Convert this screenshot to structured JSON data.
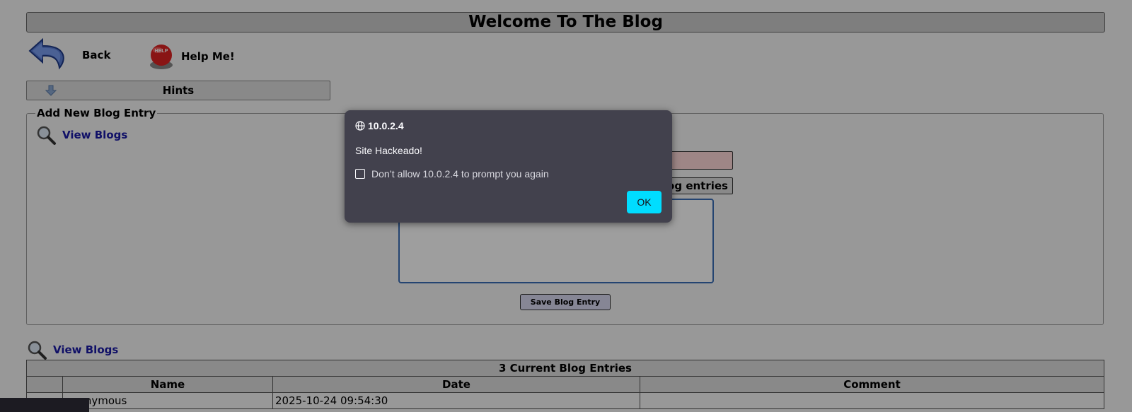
{
  "header": {
    "title": "Welcome To The Blog"
  },
  "nav": {
    "back_label": "Back",
    "help_label": "Help Me!",
    "help_badge": "HELP"
  },
  "hints": {
    "label": "Hints"
  },
  "form": {
    "legend": "Add New Blog Entry",
    "view_blogs_label": "View Blogs",
    "show_entries_label": "Show blog entries",
    "save_label": "Save Blog Entry"
  },
  "blog_list": {
    "view_blogs_label": "View Blogs",
    "caption": "3 Current Blog Entries",
    "columns": [
      "",
      "Name",
      "Date",
      "Comment"
    ],
    "rows": [
      {
        "index": "",
        "name": "anonymous",
        "date": "2025-10-24 09:54:30",
        "comment": ""
      }
    ]
  },
  "dialog": {
    "origin": "10.0.2.4",
    "message": "Site Hackeado!",
    "checkbox_label": "Don’t allow 10.0.2.4 to prompt you again",
    "checkbox_checked": false,
    "ok_label": "OK",
    "accent_color": "#00ddff",
    "background_color": "#42414d"
  }
}
